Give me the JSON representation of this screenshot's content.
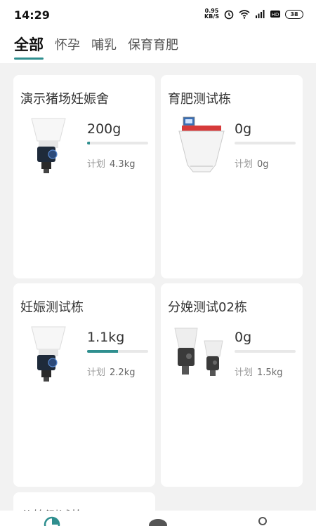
{
  "status": {
    "time": "14:29",
    "net_speed_top": "0.95",
    "net_speed_bottom": "KB/S",
    "battery": "38"
  },
  "tabs": [
    {
      "label": "全部",
      "active": true
    },
    {
      "label": "怀孕",
      "active": false
    },
    {
      "label": "哺乳",
      "active": false
    },
    {
      "label": "保育育肥",
      "active": false
    }
  ],
  "cards": [
    {
      "title": "演示猪场妊娠舍",
      "weight": "200g",
      "progress": 0.05,
      "plan_label": "计划",
      "plan_value": "4.3kg",
      "device": "sow-feeder"
    },
    {
      "title": "育肥测试栋",
      "weight": "0g",
      "progress": 0,
      "plan_label": "计划",
      "plan_value": "0g",
      "device": "fattening-feeder"
    },
    {
      "title": "妊娠测试栋",
      "weight": "1.1kg",
      "progress": 0.5,
      "plan_label": "计划",
      "plan_value": "2.2kg",
      "device": "sow-feeder"
    },
    {
      "title": "分娩测试02栋",
      "weight": "0g",
      "progress": 0,
      "plan_label": "计划",
      "plan_value": "1.5kg",
      "device": "farrowing-feeder-pair"
    },
    {
      "title": "分娩测试栋",
      "weight": "",
      "progress": 0,
      "plan_label": "",
      "plan_value": "",
      "device": ""
    }
  ],
  "colors": {
    "accent": "#2f8f8f",
    "background": "#f2f2f2",
    "card": "#ffffff"
  },
  "bottom_nav": {
    "icons": [
      "pie-chart-icon",
      "pig-icon",
      "user-icon"
    ]
  }
}
